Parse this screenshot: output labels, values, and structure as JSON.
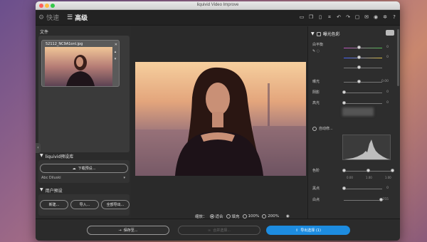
{
  "window": {
    "title": "liquivid Video Improve"
  },
  "toolbar": {
    "mode_quick": "快速",
    "mode_advanced": "高级",
    "icons": [
      "folder-icon",
      "copy-icon",
      "paste-icon",
      "crop-icon",
      "undo-icon",
      "redo-icon",
      "chat-icon",
      "mail-icon",
      "user-icon",
      "settings-icon",
      "help-icon"
    ]
  },
  "files": {
    "label": "文件",
    "thumb_name": "52112_NC9A1onl.jpg"
  },
  "library": {
    "header": "liquivid预设库",
    "download_button": "下载预设...",
    "item_label": "Abc Diluski"
  },
  "user_presets": {
    "header": "用户预设",
    "new_button": "新建...",
    "import_button": "导入...",
    "export_all_button": "全部导出..."
  },
  "zoom": {
    "label": "缩放：",
    "fit": "适合",
    "fill": "填充",
    "p100": "100%",
    "p200": "200%",
    "selected": "适合"
  },
  "adjust": {
    "section": "曝光色彩",
    "white_balance": "白平衡",
    "wb_val1": "0",
    "wb_val2": "0",
    "exposure": "曝光",
    "exposure_val": "0.00",
    "shadows": "阴影",
    "shadows_val": "0",
    "highlights": "高光",
    "highlights_val": "0",
    "auto": "自动修...",
    "tone": "色阶",
    "tone_ticks": [
      "0.00",
      "1.00",
      "1.00"
    ],
    "black": "黑点",
    "black_val": "0",
    "white": "白点",
    "white_val": "255"
  },
  "bottom": {
    "save": "保存至...",
    "merge": "合并选择...",
    "export": "导出选择 (1)"
  },
  "colors": {
    "accent": "#1d8ce0"
  }
}
